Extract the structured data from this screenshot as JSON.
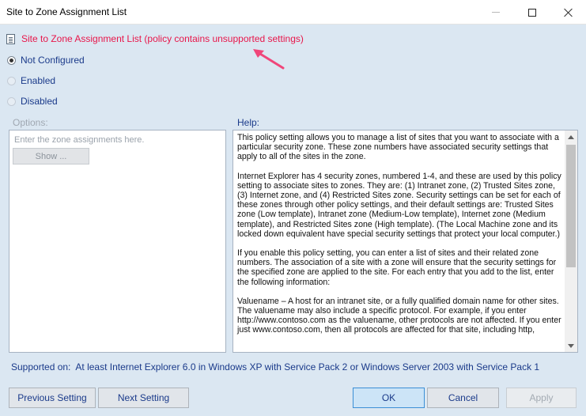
{
  "window": {
    "title": "Site to Zone Assignment List"
  },
  "policy": {
    "title": "Site to Zone Assignment List (policy contains unsupported settings)"
  },
  "state_options": [
    {
      "label": "Not Configured",
      "checked": true
    },
    {
      "label": "Enabled",
      "checked": false
    },
    {
      "label": "Disabled",
      "checked": false
    }
  ],
  "options": {
    "label": "Options:",
    "hint": "Enter the zone assignments here.",
    "show_button": "Show ..."
  },
  "help": {
    "label": "Help:",
    "paragraphs": [
      "This policy setting allows you to manage a list of sites that you want to associate with a particular security zone. These zone numbers have associated security settings that apply to all of the sites in the zone.",
      "Internet Explorer has 4 security zones, numbered 1-4, and these are used by this policy setting to associate sites to zones. They are: (1) Intranet zone, (2) Trusted Sites zone, (3) Internet zone, and (4) Restricted Sites zone. Security settings can be set for each of these zones through other policy settings, and their default settings are: Trusted Sites zone (Low template), Intranet zone (Medium-Low template), Internet zone (Medium template), and Restricted Sites zone (High template). (The Local Machine zone and its locked down equivalent have special security settings that protect your local computer.)",
      "If you enable this policy setting, you can enter a list of sites and their related zone numbers. The association of a site with a zone will ensure that the security settings for the specified zone are applied to the site. For each entry that you add to the list, enter the following information:",
      "Valuename – A host for an intranet site, or a fully qualified domain name for other sites. The valuename may also include a specific protocol. For example, if you enter http://www.contoso.com as the valuename, other protocols are not affected. If you enter just www.contoso.com, then all protocols are affected for that site, including http,"
    ]
  },
  "supported": {
    "label": "Supported on:",
    "value": "At least Internet Explorer 6.0 in Windows XP with Service Pack 2 or Windows Server 2003 with Service Pack 1"
  },
  "buttons": {
    "previous": "Previous Setting",
    "next": "Next Setting",
    "ok": "OK",
    "cancel": "Cancel",
    "apply": "Apply"
  },
  "colors": {
    "accent_red": "#e8164a",
    "annotation_pink": "#f0467a",
    "link_blue": "#1a3a8a",
    "dialog_bg": "#dbe7f2"
  }
}
